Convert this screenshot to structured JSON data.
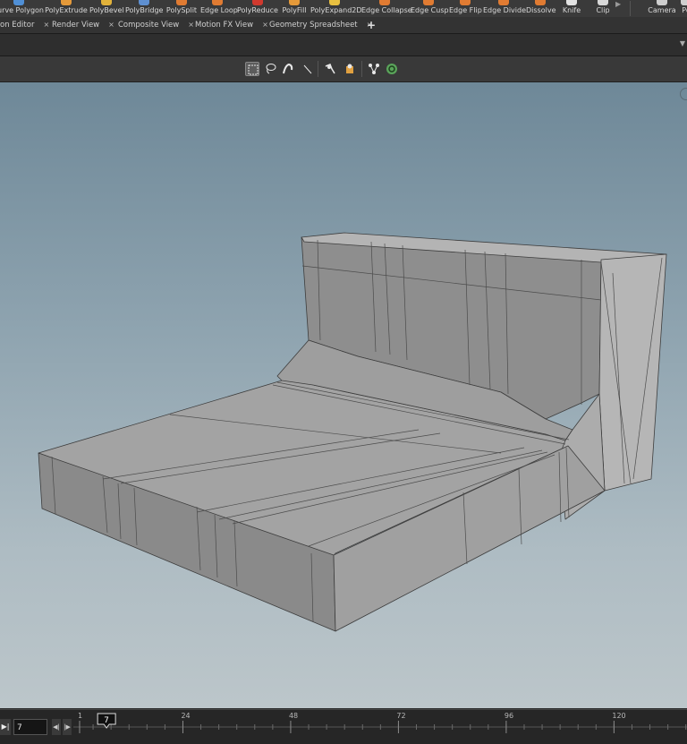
{
  "shelf": {
    "tools": [
      {
        "label": "urve Polygon",
        "icon": "curve-polygon-icon",
        "color": "#4f8fd6"
      },
      {
        "label": "PolyExtrude",
        "icon": "polyextrude-icon",
        "color": "#e59a3a"
      },
      {
        "label": "PolyBevel",
        "icon": "polybevel-icon",
        "color": "#e2b23a"
      },
      {
        "label": "PolyBridge",
        "icon": "polybridge-icon",
        "color": "#5e8fd0"
      },
      {
        "label": "PolySplit",
        "icon": "polysplit-icon",
        "color": "#e07b32"
      },
      {
        "label": "Edge Loop",
        "icon": "edge-loop-icon",
        "color": "#e07b32"
      },
      {
        "label": "PolyReduce",
        "icon": "polyreduce-icon",
        "color": "#d0392e"
      },
      {
        "label": "PolyFill",
        "icon": "polyfill-icon",
        "color": "#e59a3a"
      },
      {
        "label": "PolyExpand2D",
        "icon": "polyexpand2d-icon",
        "color": "#e8c040"
      },
      {
        "label": "Edge Collapse",
        "icon": "edge-collapse-icon",
        "color": "#e07b32"
      },
      {
        "label": "Edge Cusp",
        "icon": "edge-cusp-icon",
        "color": "#e07b32"
      },
      {
        "label": "Edge Flip",
        "icon": "edge-flip-icon",
        "color": "#e07b32"
      },
      {
        "label": "Edge Divide",
        "icon": "edge-divide-icon",
        "color": "#e07b32"
      },
      {
        "label": "Dissolve",
        "icon": "dissolve-icon",
        "color": "#e07b32"
      },
      {
        "label": "Knife",
        "icon": "knife-icon",
        "color": "#e2e2e2"
      },
      {
        "label": "Clip",
        "icon": "clip-icon",
        "color": "#d8d8d8"
      },
      {
        "label": "Camera",
        "icon": "camera-icon",
        "color": "#cfcfcf"
      },
      {
        "label": "Po",
        "icon": "point-light-icon",
        "color": "#cfcfcf"
      }
    ],
    "more_glyph": "▶"
  },
  "tabs": [
    {
      "label": "on Editor",
      "close": "×"
    },
    {
      "label": "Render View",
      "close": "×"
    },
    {
      "label": "Composite View",
      "close": "×"
    },
    {
      "label": "Motion FX View",
      "close": "×"
    },
    {
      "label": "Geometry Spreadsheet",
      "close": "×"
    }
  ],
  "tab_add": "+",
  "pathbar": {
    "arrow": "▼"
  },
  "viewport_tools": [
    "box-select-icon",
    "lasso-select-icon",
    "brush-select-icon",
    "laser-select-icon",
    "secure-selection-icon",
    "select-visible-icon",
    "select-groups-icon",
    "select-connected-icon"
  ],
  "timeline": {
    "current_frame": "7",
    "marker_label": "7",
    "ticks": [
      {
        "frame": 1,
        "label": "1"
      },
      {
        "frame": 24,
        "label": "24"
      },
      {
        "frame": 48,
        "label": "48"
      },
      {
        "frame": 72,
        "label": "72"
      },
      {
        "frame": 96,
        "label": "96"
      },
      {
        "frame": 120,
        "label": "120"
      }
    ],
    "end_glyph": "▶|",
    "step_back_glyph": "◀|",
    "step_fwd_glyph": "|▶"
  }
}
